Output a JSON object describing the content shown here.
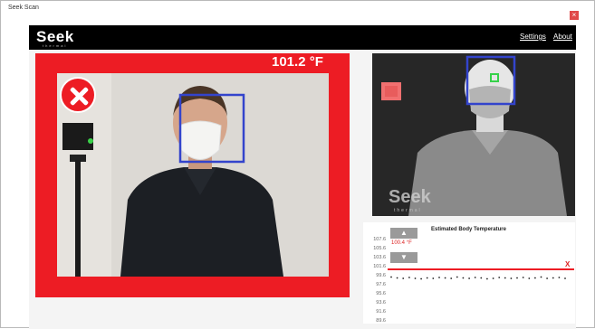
{
  "window": {
    "title": "Seek Scan",
    "close_glyph": "×"
  },
  "appbar": {
    "logo": "Seek",
    "logo_sub": "thermal",
    "nav": [
      "Settings",
      "About"
    ]
  },
  "visible_camera": {
    "temperature": "101.2 °F",
    "status": "fail",
    "alert_color": "#ed1c24",
    "face_box_color": "#3344cc"
  },
  "thermal_camera": {
    "watermark": "Seek",
    "watermark_sub": "thermal"
  },
  "graph": {
    "title": "Estimated Body Temperature",
    "current_value": "100.4 °F",
    "y_ticks": [
      "107.6",
      "105.6",
      "103.6",
      "101.6",
      "99.6",
      "97.6",
      "95.6",
      "93.6",
      "91.6",
      "89.6"
    ],
    "threshold_marker": "X",
    "chart_data": {
      "type": "scatter",
      "title": "Estimated Body Temperature",
      "ylim": [
        89.6,
        107.6
      ],
      "threshold": 100.4,
      "values": [
        99.3,
        99.1,
        99.0,
        99.2,
        99.0,
        98.9,
        99.1,
        99.0,
        99.2,
        99.1,
        99.0,
        99.3,
        99.1,
        99.0,
        99.2,
        99.1,
        98.9,
        99.0,
        99.2,
        99.1,
        99.0,
        99.1,
        99.2,
        99.0,
        99.1,
        99.3,
        99.0,
        99.1,
        99.2,
        99.0
      ]
    }
  }
}
